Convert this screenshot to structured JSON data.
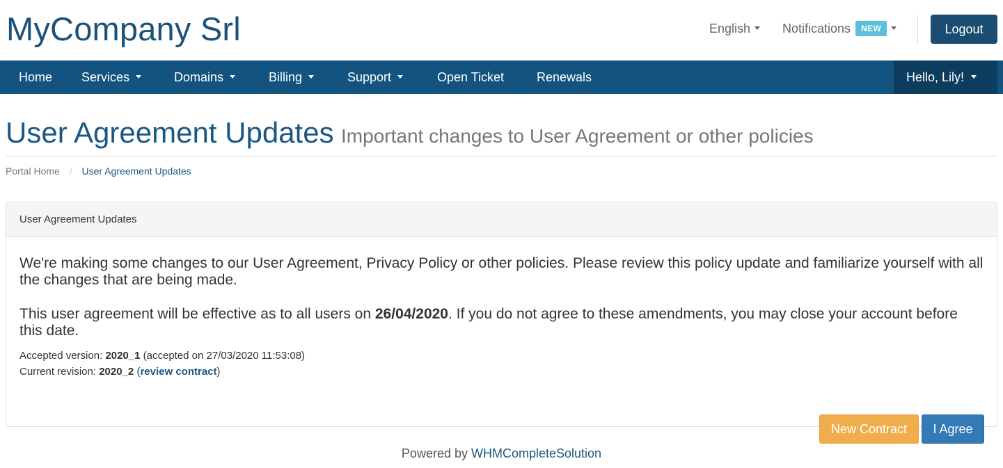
{
  "header": {
    "brand": "MyCompany Srl",
    "language_label": "English",
    "notifications_label": "Notifications",
    "notifications_badge": "NEW",
    "logout_label": "Logout"
  },
  "navbar": {
    "items": [
      {
        "label": "Home",
        "has_dropdown": false
      },
      {
        "label": "Services",
        "has_dropdown": true
      },
      {
        "label": "Domains",
        "has_dropdown": true
      },
      {
        "label": "Billing",
        "has_dropdown": true
      },
      {
        "label": "Support",
        "has_dropdown": true
      },
      {
        "label": "Open Ticket",
        "has_dropdown": false
      },
      {
        "label": "Renewals",
        "has_dropdown": false
      }
    ],
    "user_greeting": "Hello, Lily!"
  },
  "page": {
    "title": "User Agreement Updates",
    "subtitle": "Important changes to User Agreement or other policies"
  },
  "breadcrumb": {
    "home": "Portal Home",
    "separator": "/",
    "current": "User Agreement Updates"
  },
  "panel": {
    "heading": "User Agreement Updates",
    "paragraph1": "We're making some changes to our User Agreement, Privacy Policy or other policies. Please review this policy update and familiarize yourself with all the changes that are being made.",
    "paragraph2_before": "This user agreement will be effective as to all users on ",
    "paragraph2_date": "26/04/2020",
    "paragraph2_after": ". If you do not agree to these amendments, you may close your account before this date.",
    "accepted_label": "Accepted version: ",
    "accepted_version": "2020_1",
    "accepted_detail": " (accepted on 27/03/2020 11:53:08)",
    "current_label": "Current revision: ",
    "current_version": "2020_2",
    "review_open": " (",
    "review_link": "review contract",
    "review_close": ")",
    "new_contract_button": "New Contract",
    "agree_button": "I Agree"
  },
  "footer": {
    "prefix": "Powered by ",
    "link": "WHMCompleteSolution"
  },
  "colors": {
    "brand": "#1c5279",
    "navbar": "#135380",
    "navbar_user": "#0d3d5e",
    "badge": "#5bc0de",
    "warning_button": "#f0ad4e",
    "primary_button": "#337ab7"
  }
}
